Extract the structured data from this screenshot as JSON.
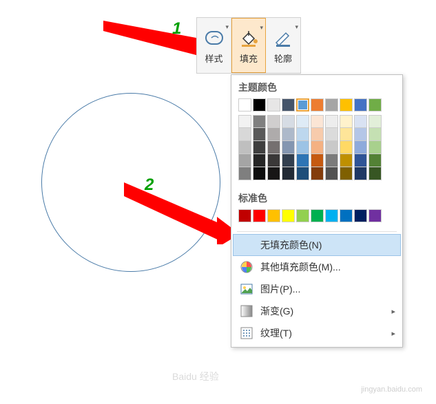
{
  "toolbar": {
    "style_label": "样式",
    "fill_label": "填充",
    "outline_label": "轮廓"
  },
  "annotations": {
    "one": "1",
    "two": "2"
  },
  "fill_panel": {
    "theme_colors_title": "主题颜色",
    "standard_colors_title": "标准色",
    "no_fill_label": "无填充颜色(N)",
    "more_colors_label": "其他填充颜色(M)...",
    "picture_label": "图片(P)...",
    "gradient_label": "渐变(G)",
    "texture_label": "纹理(T)"
  },
  "theme_colors": {
    "main": [
      "#ffffff",
      "#000000",
      "#e7e6e6",
      "#44546a",
      "#5b9bd5",
      "#ed7d31",
      "#a5a5a5",
      "#ffc000",
      "#4472c4",
      "#70ad47"
    ],
    "shades": [
      [
        "#f2f2f2",
        "#808080",
        "#d0cece",
        "#d6dce4",
        "#deebf6",
        "#fbe5d5",
        "#ededed",
        "#fff2cc",
        "#d9e2f3",
        "#e2efd9"
      ],
      [
        "#d8d8d8",
        "#595959",
        "#aeabab",
        "#adb9ca",
        "#bdd7ee",
        "#f7cbac",
        "#dbdbdb",
        "#fee599",
        "#b4c6e7",
        "#c5e0b3"
      ],
      [
        "#bfbfbf",
        "#3f3f3f",
        "#757070",
        "#8496b0",
        "#9cc3e5",
        "#f4b183",
        "#c9c9c9",
        "#ffd965",
        "#8eaadb",
        "#a8d08d"
      ],
      [
        "#a5a5a5",
        "#262626",
        "#3a3838",
        "#323f4f",
        "#2e75b5",
        "#c55a11",
        "#7b7b7b",
        "#bf9000",
        "#2f5496",
        "#538135"
      ],
      [
        "#7f7f7f",
        "#0c0c0c",
        "#171616",
        "#222a35",
        "#1e4e79",
        "#833c0b",
        "#525252",
        "#7f6000",
        "#1f3864",
        "#375623"
      ]
    ]
  },
  "standard_colors": [
    "#c00000",
    "#ff0000",
    "#ffc000",
    "#ffff00",
    "#92d050",
    "#00b050",
    "#00b0f0",
    "#0070c0",
    "#002060",
    "#7030a0"
  ],
  "selected_theme_index": 4,
  "watermark": {
    "logo": "Baidu 经验",
    "url": "jingyan.baidu.com"
  }
}
